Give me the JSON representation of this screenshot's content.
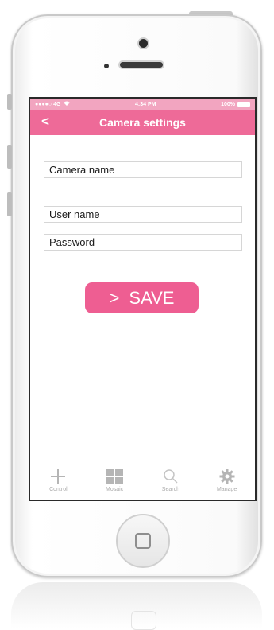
{
  "colors": {
    "accent": "#ee6a98",
    "statusbar_bg": "#f2a5c0",
    "button_bg": "#ee5e92",
    "tab_label": "#a9a9a9"
  },
  "status_bar": {
    "carrier": "●●●●○ 4G",
    "time": "4:34 PM",
    "battery": "100%"
  },
  "nav": {
    "back_label": "<",
    "title": "Camera settings"
  },
  "form": {
    "camera_name_placeholder": "Camera name",
    "user_name_placeholder": "User name",
    "password_placeholder": "Password",
    "save_chevron": ">",
    "save_label": "SAVE"
  },
  "tabs": [
    {
      "label": "Control",
      "icon": "plus-icon"
    },
    {
      "label": "Mosaic",
      "icon": "grid-icon"
    },
    {
      "label": "Search",
      "icon": "search-icon"
    },
    {
      "label": "Manage",
      "icon": "gear-icon"
    }
  ]
}
